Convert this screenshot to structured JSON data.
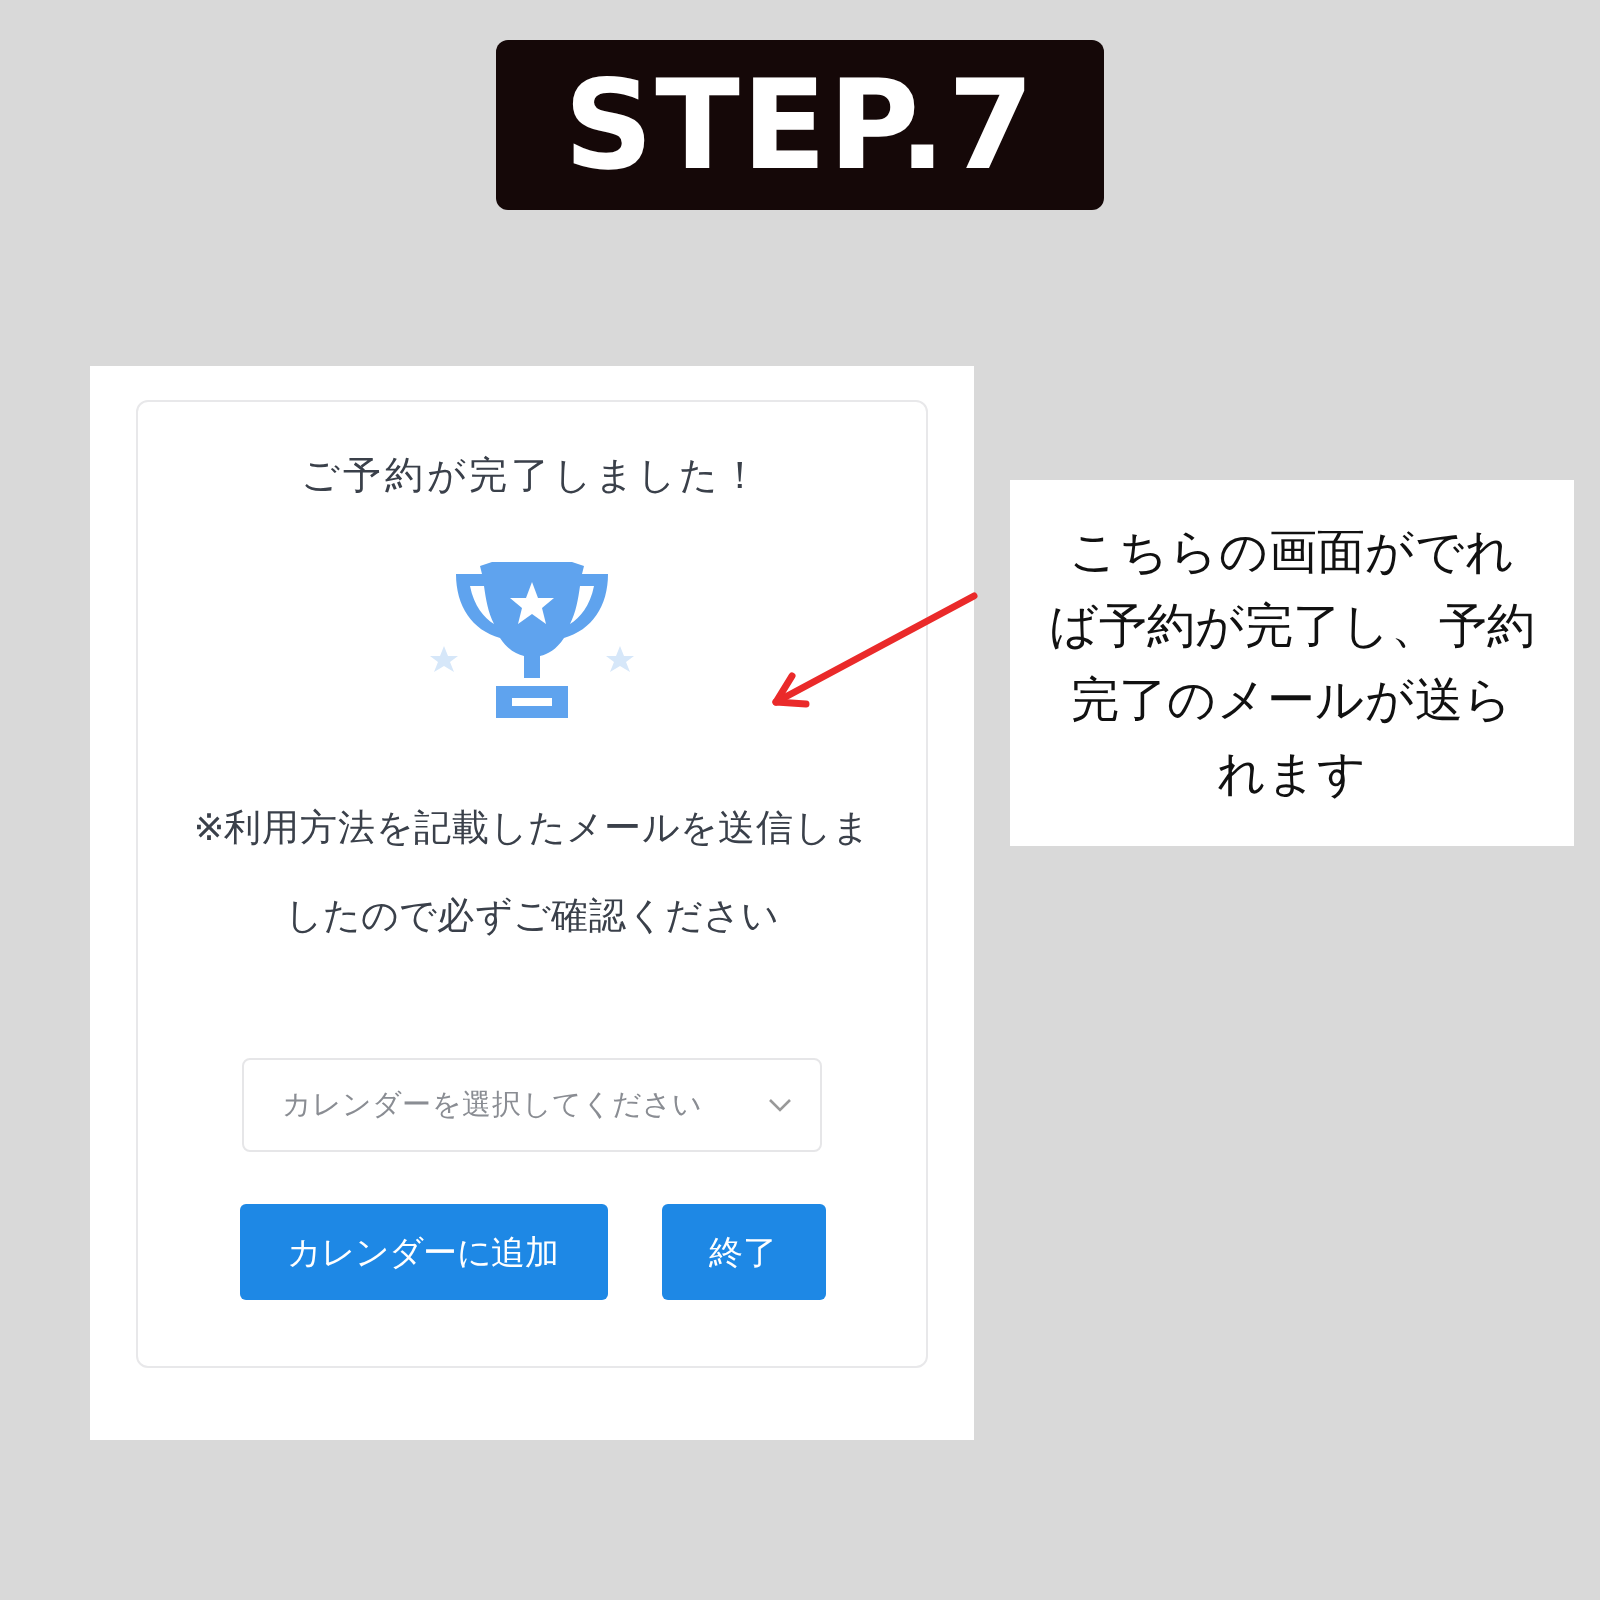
{
  "header": {
    "title": "STEP.7"
  },
  "screen": {
    "title": "ご予約が完了しました！",
    "message": "※利用方法を記載したメールを送信しましたので必ずご確認ください",
    "calendar_select": {
      "placeholder": "カレンダーを選択してください"
    },
    "buttons": [
      {
        "label": "カレンダーに追加"
      },
      {
        "label": "終了"
      }
    ]
  },
  "callout": {
    "text": "こちらの画面がでれば予約が完了し、予約完了のメールが送られます"
  }
}
